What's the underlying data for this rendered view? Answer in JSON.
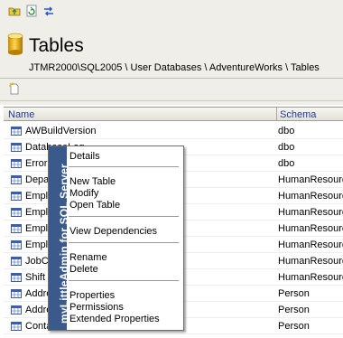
{
  "header": {
    "title": "Tables",
    "breadcrumb": "JTMR2000\\SQL2005 \\ User Databases \\ AdventureWorks \\ Tables"
  },
  "toolbar": {
    "icons": [
      "folder-up-icon",
      "refresh-icon",
      "sync-icon"
    ],
    "new_icon": "new-item-icon"
  },
  "grid": {
    "columns": [
      "Name",
      "Schema"
    ],
    "rows": [
      {
        "name": "AWBuildVersion",
        "schema": "dbo"
      },
      {
        "name": "DatabaseLog",
        "schema": "dbo"
      },
      {
        "name": "ErrorLog",
        "schema": "dbo"
      },
      {
        "name": "Department",
        "schema": "HumanResources"
      },
      {
        "name": "Employee",
        "schema": "HumanResources"
      },
      {
        "name": "EmployeeAddress",
        "schema": "HumanResources"
      },
      {
        "name": "EmployeeDepartmentHistory",
        "schema": "HumanResources"
      },
      {
        "name": "EmployeePayHistory",
        "schema": "HumanResources"
      },
      {
        "name": "JobCandidate",
        "schema": "HumanResources"
      },
      {
        "name": "Shift",
        "schema": "HumanResources"
      },
      {
        "name": "Address",
        "schema": "Person"
      },
      {
        "name": "AddressType",
        "schema": "Person"
      },
      {
        "name": "Contact",
        "schema": "Person"
      }
    ]
  },
  "context_menu": {
    "band_label": "myLittleAdmin for SQL Server",
    "groups": [
      [
        "Details"
      ],
      [
        "New Table",
        "Modify",
        "Open Table"
      ],
      [
        "View Dependencies"
      ],
      [
        "Rename",
        "Delete"
      ],
      [
        "Properties",
        "Permissions",
        "Extended Properties"
      ]
    ]
  },
  "colors": {
    "header_text": "#1f3a9a",
    "menu_band": "#3b5a8c",
    "toolbar_bg": "#efeee8"
  }
}
